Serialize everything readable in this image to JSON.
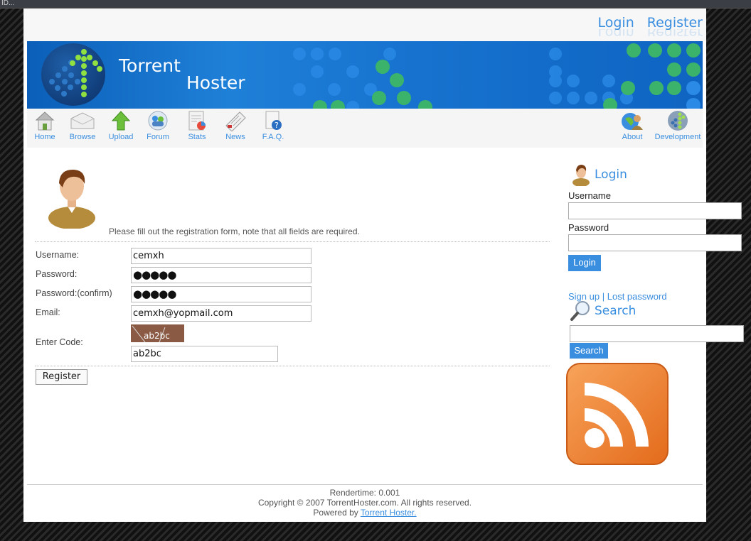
{
  "window": {
    "title": "ID..."
  },
  "header": {
    "login": "Login",
    "register": "Register"
  },
  "banner": {
    "brand_line1": "Torrent",
    "brand_line2": "Hoster"
  },
  "nav": {
    "left": [
      {
        "label": "Home",
        "icon": "home-icon"
      },
      {
        "label": "Browse",
        "icon": "browse-icon"
      },
      {
        "label": "Upload",
        "icon": "upload-icon"
      },
      {
        "label": "Forum",
        "icon": "forum-icon"
      },
      {
        "label": "Stats",
        "icon": "stats-icon"
      },
      {
        "label": "News",
        "icon": "news-icon"
      },
      {
        "label": "F.A.Q.",
        "icon": "faq-icon"
      }
    ],
    "right": [
      {
        "label": "About",
        "icon": "about-icon"
      },
      {
        "label": "Development",
        "icon": "development-icon"
      }
    ]
  },
  "form": {
    "intro": "Please fill out the registration form, note that all fields are required.",
    "username_label": "Username:",
    "username_value": "cemxh",
    "password_label": "Password:",
    "password_value": "●●●●●",
    "password_confirm_label": "Password:(confirm)",
    "password_confirm_value": "●●●●●",
    "email_label": "Email:",
    "email_value": "cemxh@yopmail.com",
    "code_label": "Enter Code:",
    "captcha_text": "ab2bc",
    "code_value": "ab2bc",
    "register_button": "Register"
  },
  "sidebar": {
    "login_title": "Login",
    "username_label": "Username",
    "password_label": "Password",
    "login_button": "Login",
    "signup_link": "Sign up",
    "link_separator": "|",
    "lost_password_link": "Lost password",
    "search_title": "Search",
    "search_button": "Search"
  },
  "footer": {
    "rendertime": "Rendertime: 0.001",
    "copyright": "Copyright © 2007 TorrentHoster.com. All rights reserved.",
    "powered_by": "Powered by",
    "powered_link": "Torrent Hoster."
  },
  "colors": {
    "accent": "#3a8ee0",
    "banner": "#1773cf",
    "captcha_bg": "#8b5a45",
    "rss": "#e9792a"
  }
}
